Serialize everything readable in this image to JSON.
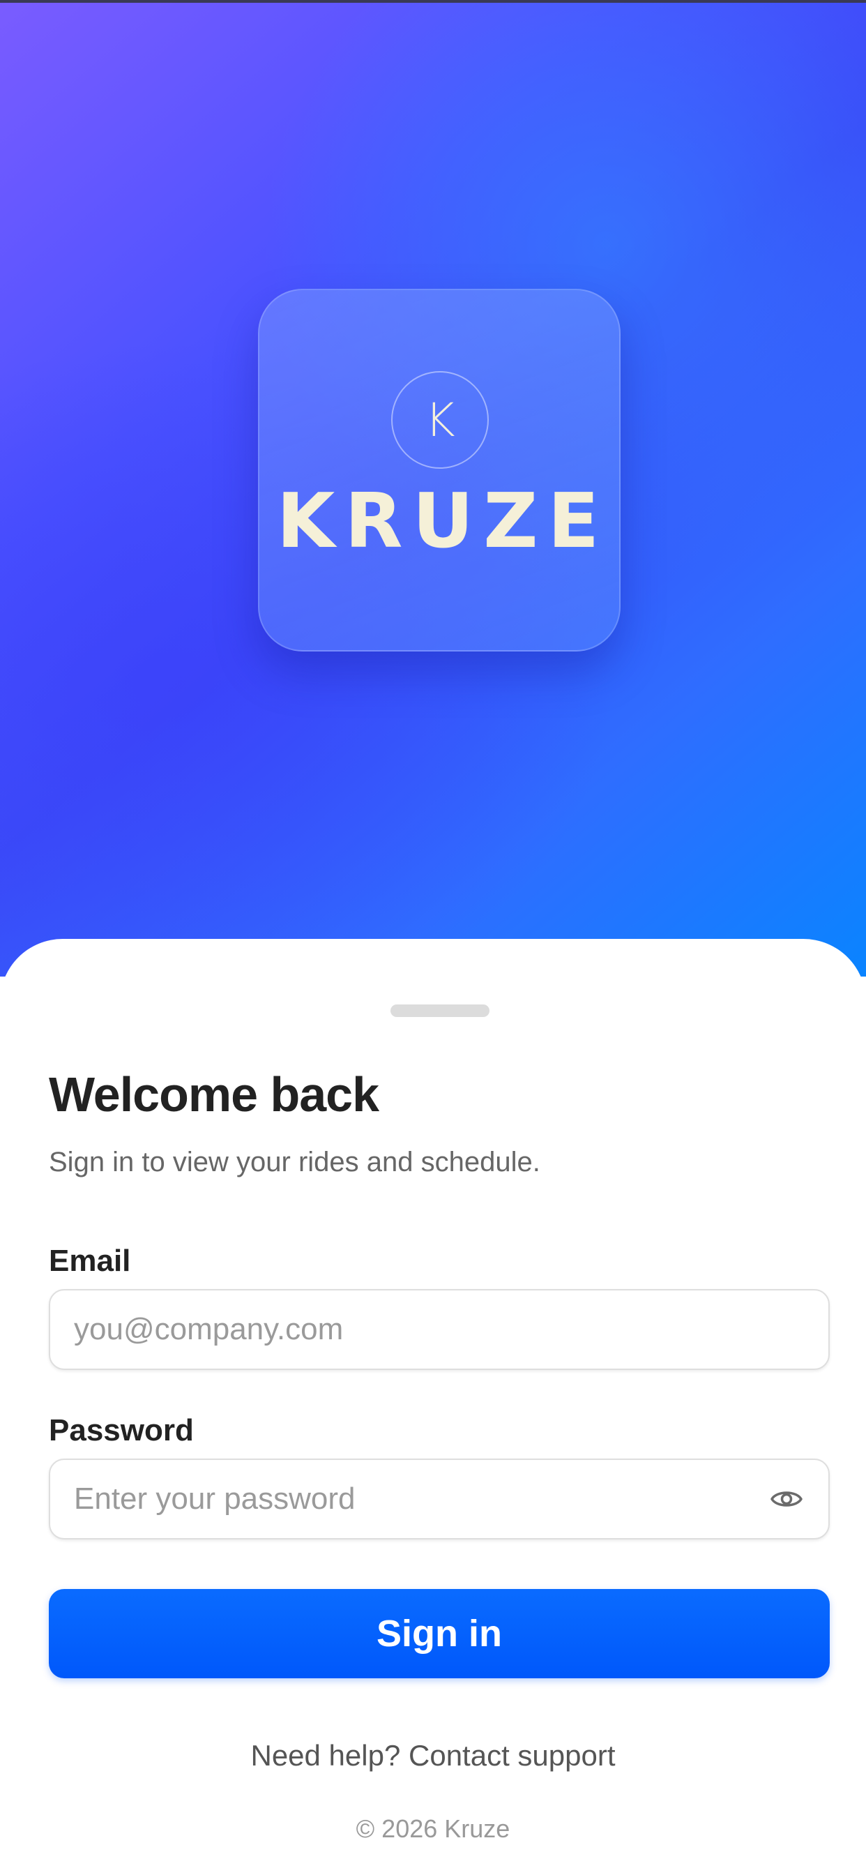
{
  "hero": {
    "logo_letter": "K",
    "logo_wordmark": "KRUZE"
  },
  "login": {
    "title": "Welcome back",
    "subtitle": "Sign in to view your rides and schedule.",
    "email": {
      "label": "Email",
      "placeholder": "you@company.com",
      "value": ""
    },
    "password": {
      "label": "Password",
      "placeholder": "Enter your password",
      "value": "",
      "toggle_icon": "eye-icon"
    },
    "submit_label": "Sign in",
    "help": {
      "prefix": "Need help?",
      "link": "Contact support"
    },
    "copyright": "© 2026 Kruze"
  },
  "colors": {
    "primary": "#0058fb",
    "logo_text": "#f5f0d8",
    "title_text": "#222222",
    "muted_text": "#666666"
  }
}
